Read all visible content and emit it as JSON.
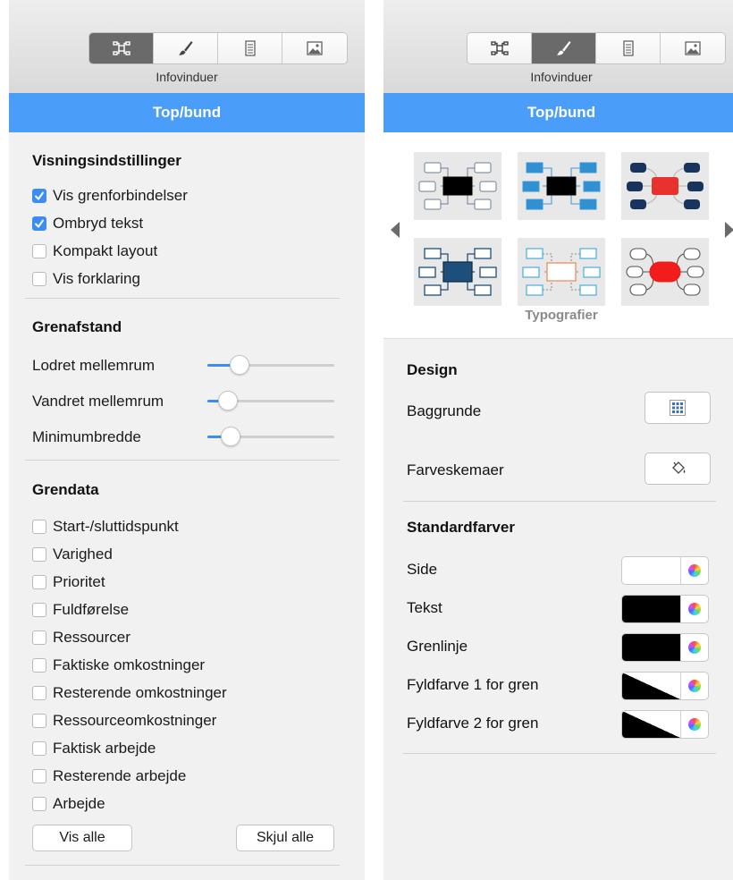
{
  "colors": {
    "accent": "#4a9df8",
    "checkbox": "#3b8cf6"
  },
  "left": {
    "toolbar_caption": "Infovinduer",
    "header": "Top/bund",
    "visning": {
      "title": "Visningsindstillinger",
      "items": [
        {
          "label": "Vis grenforbindelser",
          "checked": true
        },
        {
          "label": "Ombryd tekst",
          "checked": true
        },
        {
          "label": "Kompakt layout",
          "checked": false
        },
        {
          "label": "Vis forklaring",
          "checked": false
        }
      ]
    },
    "grenafstand": {
      "title": "Grenafstand",
      "sliders": [
        {
          "label": "Lodret mellemrum",
          "value": 0.25
        },
        {
          "label": "Vandret mellemrum",
          "value": 0.16
        },
        {
          "label": "Minimumbredde",
          "value": 0.18
        }
      ]
    },
    "grendata": {
      "title": "Grendata",
      "items": [
        {
          "label": "Start-/sluttidspunkt",
          "checked": false
        },
        {
          "label": "Varighed",
          "checked": false
        },
        {
          "label": "Prioritet",
          "checked": false
        },
        {
          "label": "Fuldførelse",
          "checked": false
        },
        {
          "label": "Ressourcer",
          "checked": false
        },
        {
          "label": "Faktiske omkostninger",
          "checked": false
        },
        {
          "label": "Resterende omkostninger",
          "checked": false
        },
        {
          "label": "Ressourceomkostninger",
          "checked": false
        },
        {
          "label": "Faktisk arbejde",
          "checked": false
        },
        {
          "label": "Resterende arbejde",
          "checked": false
        },
        {
          "label": "Arbejde",
          "checked": false
        }
      ],
      "show_all": "Vis alle",
      "hide_all": "Skjul alle"
    }
  },
  "right": {
    "toolbar_caption": "Infovinduer",
    "header": "Top/bund",
    "gallery_caption": "Typografier",
    "design": {
      "title": "Design",
      "backgrounds_label": "Baggrunde",
      "color_schemes_label": "Farveskemaer"
    },
    "standard": {
      "title": "Standardfarver",
      "rows": [
        {
          "label": "Side",
          "swatch": "white"
        },
        {
          "label": "Tekst",
          "swatch": "black"
        },
        {
          "label": "Grenlinje",
          "swatch": "black"
        },
        {
          "label": "Fyldfarve 1 for gren",
          "swatch": "black-white-diagonal"
        },
        {
          "label": "Fyldfarve 2 for gren",
          "swatch": "black-white-diagonal"
        }
      ]
    }
  }
}
